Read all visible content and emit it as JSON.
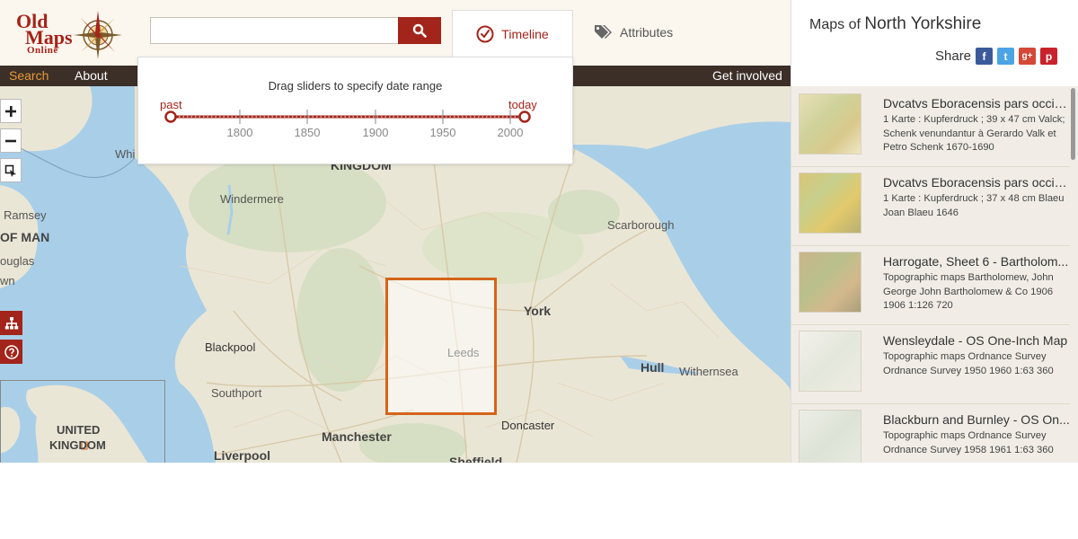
{
  "header": {
    "logo": {
      "line1": "Old",
      "line2": "Maps",
      "line3": "Online"
    },
    "search": {
      "placeholder": ""
    },
    "tabs": [
      {
        "label": "Timeline",
        "icon": "clock-icon",
        "active": true
      },
      {
        "label": "Attributes",
        "icon": "tag-icon",
        "active": false
      }
    ]
  },
  "nav": {
    "items": [
      "Search",
      "About",
      "Get involved"
    ],
    "active": "Search"
  },
  "timeline": {
    "instruction": "Drag sliders to specify date range",
    "start_label": "past",
    "end_label": "today",
    "ticks": [
      "1800",
      "1850",
      "1900",
      "1950",
      "2000"
    ]
  },
  "map": {
    "controls": [
      "zoom-in",
      "zoom-out",
      "select-area"
    ],
    "labels": {
      "whi": "Whi",
      "kingdom": "KINGDOM",
      "windermere": "Windermere",
      "ramsey": "Ramsey",
      "of_man": "OF MAN",
      "ouglas": "ouglas",
      "wn": "wn",
      "scarborough": "Scarborough",
      "york": "York",
      "leeds": "Leeds",
      "blackpool": "Blackpool",
      "hull": "Hull",
      "withernsea": "Withernsea",
      "southport": "Southport",
      "doncaster": "Doncaster",
      "manchester": "Manchester",
      "liverpool": "Liverpool",
      "sheffield": "Sheffield",
      "united": "UNITED",
      "kingdom2": "KINGDOM"
    }
  },
  "sidebar": {
    "title_prefix": "Maps of",
    "place": "North Yorkshire",
    "share_label": "Share",
    "share_icons": [
      "facebook-icon",
      "twitter-icon",
      "googleplus-icon",
      "pinterest-icon"
    ],
    "items": [
      {
        "title": "Dvcatvs Eboracensis pars occid...",
        "desc": "1 Karte : Kupferdruck ; 39 x 47 cm Valck; Schenk venundantur à Gerardo Valk et Petro Schenk 1670-1690"
      },
      {
        "title": "Dvcatvs Eboracensis pars occid...",
        "desc": "1 Karte : Kupferdruck ; 37 x 48 cm Blaeu Joan Blaeu 1646"
      },
      {
        "title": "Harrogate, Sheet 6 - Bartholom...",
        "desc": "Topographic maps Bartholomew, John George John Bartholomew & Co 1906 1906 1:126 720"
      },
      {
        "title": "Wensleydale - OS One-Inch Map",
        "desc": "Topographic maps Ordnance Survey Ordnance Survey 1950 1960 1:63 360"
      },
      {
        "title": "Blackburn and Burnley - OS On...",
        "desc": "Topographic maps Ordnance Survey Ordnance Survey 1958 1961 1:63 360"
      }
    ]
  },
  "colors": {
    "brand_red": "#a3241a",
    "nav_bg": "#3b2f28",
    "nav_active": "#e89a36",
    "selection": "#d5641a"
  }
}
